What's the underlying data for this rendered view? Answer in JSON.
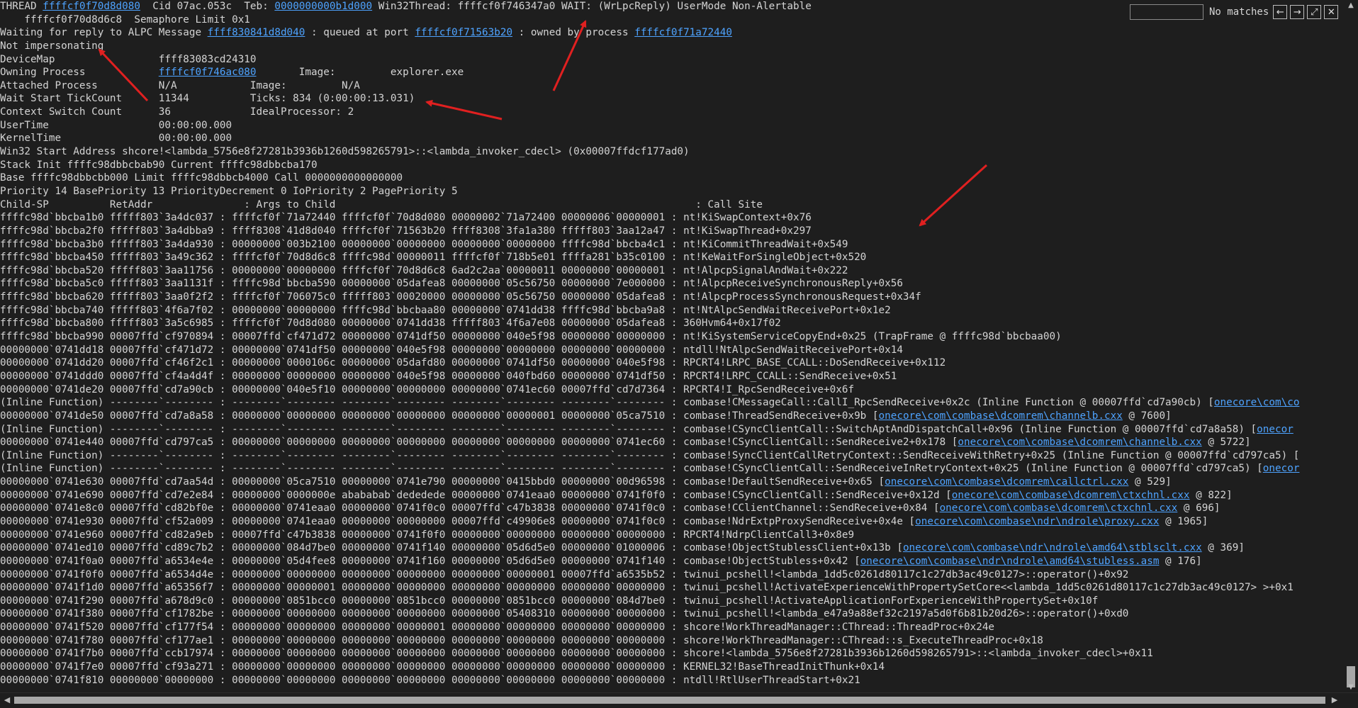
{
  "find": {
    "placeholder": "",
    "status": "No matches",
    "prev": "←",
    "next": "→",
    "expand": "⤢",
    "close": "✕"
  },
  "header": [
    [
      {
        "t": "THREAD "
      },
      {
        "t": "ffffcf0f70d8d080",
        "l": 1
      },
      {
        "t": "  Cid 07ac.053c  Teb: "
      },
      {
        "t": "0000000000b1d000",
        "l": 1
      },
      {
        "t": " Win32Thread: ffffcf0f746347a0 WAIT: (WrLpcReply) UserMode Non-Alertable"
      }
    ],
    [
      {
        "t": "    ffffcf0f70d8d6c8  Semaphore Limit 0x1",
        "i": 1
      }
    ],
    [
      {
        "t": "Waiting for reply to ALPC Message "
      },
      {
        "t": "ffff830841d8d040",
        "l": 1
      },
      {
        "t": " : queued at port "
      },
      {
        "t": "ffffcf0f71563b20",
        "l": 1
      },
      {
        "t": " : owned by process "
      },
      {
        "t": "ffffcf0f71a72440",
        "l": 1
      }
    ],
    [
      {
        "t": "Not impersonating"
      }
    ],
    [
      {
        "t": "DeviceMap                 ffff83083cd24310"
      }
    ],
    [
      {
        "t": "Owning Process            "
      },
      {
        "t": "ffffcf0f746ac080",
        "l": 1
      },
      {
        "t": "       Image:         explorer.exe"
      }
    ],
    [
      {
        "t": "Attached Process          N/A            Image:         N/A"
      }
    ],
    [
      {
        "t": "Wait Start TickCount      11344          Ticks: 834 (0:00:00:13.031)"
      }
    ],
    [
      {
        "t": "Context Switch Count      36             IdealProcessor: 2"
      }
    ],
    [
      {
        "t": "UserTime                  00:00:00.000"
      }
    ],
    [
      {
        "t": "KernelTime                00:00:00.000"
      }
    ],
    [
      {
        "t": "Win32 Start Address shcore!<lambda_5756e8f27281b3936b1260d598265791>::<lambda_invoker_cdecl> (0x00007ffdcf177ad0)"
      }
    ],
    [
      {
        "t": "Stack Init ffffc98dbbcbab90 Current ffffc98dbbcba170"
      }
    ],
    [
      {
        "t": "Base ffffc98dbbcbb000 Limit ffffc98dbbcb4000 Call 0000000000000000"
      }
    ],
    [
      {
        "t": "Priority 14 BasePriority 13 PriorityDecrement 0 IoPriority 2 PagePriority 5"
      }
    ],
    [
      {
        "t": "Child-SP          RetAddr               : Args to Child                                                           : Call Site"
      }
    ]
  ],
  "stack": [
    [
      "ffffc98d`bbcba1b0 fffff803`3a4dc037",
      "ffffcf0f`71a72440 ffffcf0f`70d8d080 00000002`71a72400 00000006`00000001",
      [
        {
          "t": "nt!KiSwapContext+0x76"
        }
      ]
    ],
    [
      "ffffc98d`bbcba2f0 fffff803`3a4dbba9",
      "ffff8308`41d8d040 ffffcf0f`71563b20 ffff8308`3fa1a380 fffff803`3aa12a47",
      [
        {
          "t": "nt!KiSwapThread+0x297"
        }
      ]
    ],
    [
      "ffffc98d`bbcba3b0 fffff803`3a4da930",
      "00000000`003b2100 00000000`00000000 00000000`00000000 ffffc98d`bbcba4c1",
      [
        {
          "t": "nt!KiCommitThreadWait+0x549"
        }
      ]
    ],
    [
      "ffffc98d`bbcba450 fffff803`3a49c362",
      "ffffcf0f`70d8d6c8 ffffc98d`00000011 ffffcf0f`718b5e01 ffffa281`b35c0100",
      [
        {
          "t": "nt!KeWaitForSingleObject+0x520"
        }
      ]
    ],
    [
      "ffffc98d`bbcba520 fffff803`3aa11756",
      "00000000`00000000 ffffcf0f`70d8d6c8 6ad2c2aa`00000011 00000000`00000001",
      [
        {
          "t": "nt!AlpcpSignalAndWait+0x222"
        }
      ]
    ],
    [
      "ffffc98d`bbcba5c0 fffff803`3aa1131f",
      "ffffc98d`bbcba590 00000000`05dafea8 00000000`05c56750 00000000`7e000000",
      [
        {
          "t": "nt!AlpcpReceiveSynchronousReply+0x56"
        }
      ]
    ],
    [
      "ffffc98d`bbcba620 fffff803`3aa0f2f2",
      "ffffcf0f`706075c0 fffff803`00020000 00000000`05c56750 00000000`05dafea8",
      [
        {
          "t": "nt!AlpcpProcessSynchronousRequest+0x34f"
        }
      ]
    ],
    [
      "ffffc98d`bbcba740 fffff803`4f6a7f02",
      "00000000`00000000 ffffc98d`bbcbaa80 00000000`0741dd38 ffffc98d`bbcba9a8",
      [
        {
          "t": "nt!NtAlpcSendWaitReceivePort+0x1e2"
        }
      ]
    ],
    [
      "ffffc98d`bbcba800 fffff803`3a5c6985",
      "ffffcf0f`70d8d080 00000000`0741dd38 fffff803`4f6a7e08 00000000`05dafea8",
      [
        {
          "t": "360Hvm64+0x17f02"
        }
      ]
    ],
    [
      "ffffc98d`bbcba990 00007ffd`cf970894",
      "00007ffd`cf471d72 00000000`0741df50 00000000`040e5f98 00000000`00000000",
      [
        {
          "t": "nt!KiSystemServiceCopyEnd+0x25 (TrapFrame @ ffffc98d`bbcbaa00)"
        }
      ]
    ],
    [
      "00000000`0741dd18 00007ffd`cf471d72",
      "00000000`0741df50 00000000`040e5f98 00000000`00000000 00000000`00000000",
      [
        {
          "t": "ntdll!NtAlpcSendWaitReceivePort+0x14"
        }
      ]
    ],
    [
      "00000000`0741dd20 00007ffd`cf46f2c1",
      "00000000`0000106c 00000000`05dafd80 00000000`0741df50 00000000`040e5f98",
      [
        {
          "t": "RPCRT4!LRPC_BASE_CCALL::DoSendReceive+0x112"
        }
      ]
    ],
    [
      "00000000`0741ddd0 00007ffd`cf4a4d4f",
      "00000000`00000000 00000000`040e5f98 00000000`040fbd60 00000000`0741df50",
      [
        {
          "t": "RPCRT4!LRPC_CCALL::SendReceive+0x51"
        }
      ]
    ],
    [
      "00000000`0741de20 00007ffd`cd7a90cb",
      "00000000`040e5f10 00000000`00000000 00000000`0741ec60 00007ffd`cd7d7364",
      [
        {
          "t": "RPCRT4!I_RpcSendReceive+0x6f"
        }
      ]
    ],
    [
      "(Inline Function) --------`--------",
      "--------`-------- --------`-------- --------`-------- --------`--------",
      [
        {
          "t": "combase!CMessageCall::CallI_RpcSendReceive+0x2c (Inline Function @ 00007ffd`cd7a90cb) ["
        },
        {
          "t": "onecore\\com\\co",
          "l": 1
        }
      ]
    ],
    [
      "00000000`0741de50 00007ffd`cd7a8a58",
      "00000000`00000000 00000000`00000000 00000000`00000001 00000000`05ca7510",
      [
        {
          "t": "combase!ThreadSendReceive+0x9b ["
        },
        {
          "t": "onecore\\com\\combase\\dcomrem\\channelb.cxx",
          "l": 1
        },
        {
          "t": " @ 7600]"
        }
      ]
    ],
    [
      "(Inline Function) --------`--------",
      "--------`-------- --------`-------- --------`-------- --------`--------",
      [
        {
          "t": "combase!CSyncClientCall::SwitchAptAndDispatchCall+0x96 (Inline Function @ 00007ffd`cd7a8a58) ["
        },
        {
          "t": "onecor",
          "l": 1
        }
      ]
    ],
    [
      "00000000`0741e440 00007ffd`cd797ca5",
      "00000000`00000000 00000000`00000000 00000000`00000000 00000000`0741ec60",
      [
        {
          "t": "combase!CSyncClientCall::SendReceive2+0x178 ["
        },
        {
          "t": "onecore\\com\\combase\\dcomrem\\channelb.cxx",
          "l": 1
        },
        {
          "t": " @ 5722]"
        }
      ]
    ],
    [
      "(Inline Function) --------`--------",
      "--------`-------- --------`-------- --------`-------- --------`--------",
      [
        {
          "t": "combase!SyncClientCallRetryContext::SendReceiveWithRetry+0x25 (Inline Function @ 00007ffd`cd797ca5) ["
        }
      ]
    ],
    [
      "(Inline Function) --------`--------",
      "--------`-------- --------`-------- --------`-------- --------`--------",
      [
        {
          "t": "combase!CSyncClientCall::SendReceiveInRetryContext+0x25 (Inline Function @ 00007ffd`cd797ca5) ["
        },
        {
          "t": "onecor",
          "l": 1
        }
      ]
    ],
    [
      "00000000`0741e630 00007ffd`cd7aa54d",
      "00000000`05ca7510 00000000`0741e790 00000000`0415bbd0 00000000`00d96598",
      [
        {
          "t": "combase!DefaultSendReceive+0x65 ["
        },
        {
          "t": "onecore\\com\\combase\\dcomrem\\callctrl.cxx",
          "l": 1
        },
        {
          "t": " @ 529]"
        }
      ]
    ],
    [
      "00000000`0741e690 00007ffd`cd7e2e84",
      "00000000`0000000e abababab`dededede 00000000`0741eaa0 00000000`0741f0f0",
      [
        {
          "t": "combase!CSyncClientCall::SendReceive+0x12d ["
        },
        {
          "t": "onecore\\com\\combase\\dcomrem\\ctxchnl.cxx",
          "l": 1
        },
        {
          "t": " @ 822]"
        }
      ]
    ],
    [
      "00000000`0741e8c0 00007ffd`cd82bf0e",
      "00000000`0741eaa0 00000000`0741f0c0 00007ffd`c47b3838 00000000`0741f0c0",
      [
        {
          "t": "combase!CClientChannel::SendReceive+0x84 ["
        },
        {
          "t": "onecore\\com\\combase\\dcomrem\\ctxchnl.cxx",
          "l": 1
        },
        {
          "t": " @ 696]"
        }
      ]
    ],
    [
      "00000000`0741e930 00007ffd`cf52a009",
      "00000000`0741eaa0 00000000`00000000 00007ffd`c49906e8 00000000`0741f0c0",
      [
        {
          "t": "combase!NdrExtpProxySendReceive+0x4e ["
        },
        {
          "t": "onecore\\com\\combase\\ndr\\ndrole\\proxy.cxx",
          "l": 1
        },
        {
          "t": " @ 1965]"
        }
      ]
    ],
    [
      "00000000`0741e960 00007ffd`cd82a9eb",
      "00007ffd`c47b3838 00000000`0741f0f0 00000000`00000000 00000000`00000000",
      [
        {
          "t": "RPCRT4!NdrpClientCall3+0x8e9"
        }
      ]
    ],
    [
      "00000000`0741ed10 00007ffd`cd89c7b2",
      "00000000`084d7be0 00000000`0741f140 00000000`05d6d5e0 00000000`01000006",
      [
        {
          "t": "combase!ObjectStublessClient+0x13b ["
        },
        {
          "t": "onecore\\com\\combase\\ndr\\ndrole\\amd64\\stblsclt.cxx",
          "l": 1
        },
        {
          "t": " @ 369]"
        }
      ]
    ],
    [
      "00000000`0741f0a0 00007ffd`a6534e4e",
      "00000000`05d4fee8 00000000`0741f160 00000000`05d6d5e0 00000000`0741f140",
      [
        {
          "t": "combase!ObjectStubless+0x42 ["
        },
        {
          "t": "onecore\\com\\combase\\ndr\\ndrole\\amd64\\stubless.asm",
          "l": 1
        },
        {
          "t": " @ 176]"
        }
      ]
    ],
    [
      "00000000`0741f0f0 00007ffd`a6534d4e",
      "00000000`00000000 00000000`00000000 00000000`00000001 00007ffd`a6535b52",
      [
        {
          "t": "twinui_pcshell!<lambda_1dd5c0261d80117c1c27db3ac49c0127>::operator()+0x92"
        }
      ]
    ],
    [
      "00000000`0741f1d0 00007ffd`a65356f7",
      "00000000`00000001 00000000`00000000 00000000`00000000 00000000`00000000",
      [
        {
          "t": "twinui_pcshell!ActivateExperienceWithPropertySetCore<<lambda_1dd5c0261d80117c1c27db3ac49c0127> >+0x1"
        }
      ]
    ],
    [
      "00000000`0741f290 00007ffd`a678d9c0",
      "00000000`0851bcc0 00000000`0851bcc0 00000000`0851bcc0 00000000`084d7be0",
      [
        {
          "t": "twinui_pcshell!ActivateApplicationForExperienceWithPropertySet+0x10f"
        }
      ]
    ],
    [
      "00000000`0741f380 00007ffd`cf1782be",
      "00000000`00000000 00000000`00000000 00000000`05408310 00000000`00000000",
      [
        {
          "t": "twinui_pcshell!<lambda_e47a9a88ef32c2197a5d0f6b81b20d26>::operator()+0xd0"
        }
      ]
    ],
    [
      "00000000`0741f520 00007ffd`cf177f54",
      "00000000`00000000 00000000`00000001 00000000`00000000 00000000`00000000",
      [
        {
          "t": "shcore!WorkThreadManager::CThread::ThreadProc+0x24e"
        }
      ]
    ],
    [
      "00000000`0741f780 00007ffd`cf177ae1",
      "00000000`00000000 00000000`00000000 00000000`00000000 00000000`00000000",
      [
        {
          "t": "shcore!WorkThreadManager::CThread::s_ExecuteThreadProc+0x18"
        }
      ]
    ],
    [
      "00000000`0741f7b0 00007ffd`ccb17974",
      "00000000`00000000 00000000`00000000 00000000`00000000 00000000`00000000",
      [
        {
          "t": "shcore!<lambda_5756e8f27281b3936b1260d598265791>::<lambda_invoker_cdecl>+0x11"
        }
      ]
    ],
    [
      "00000000`0741f7e0 00007ffd`cf93a271",
      "00000000`00000000 00000000`00000000 00000000`00000000 00000000`00000000",
      [
        {
          "t": "KERNEL32!BaseThreadInitThunk+0x14"
        }
      ]
    ],
    [
      "00000000`0741f810 00000000`00000000",
      "00000000`00000000 00000000`00000000 00000000`00000000 00000000`00000000",
      [
        {
          "t": "ntdll!RtlUserThreadStart+0x21"
        }
      ]
    ]
  ],
  "scroll": {
    "up": "▲",
    "down": "▼",
    "left": "◀",
    "right": "▶"
  },
  "colors": {
    "background": "#1e1e1e",
    "text": "#d4d4d4",
    "link": "#4ea3ff",
    "arrow": "#e02020"
  }
}
